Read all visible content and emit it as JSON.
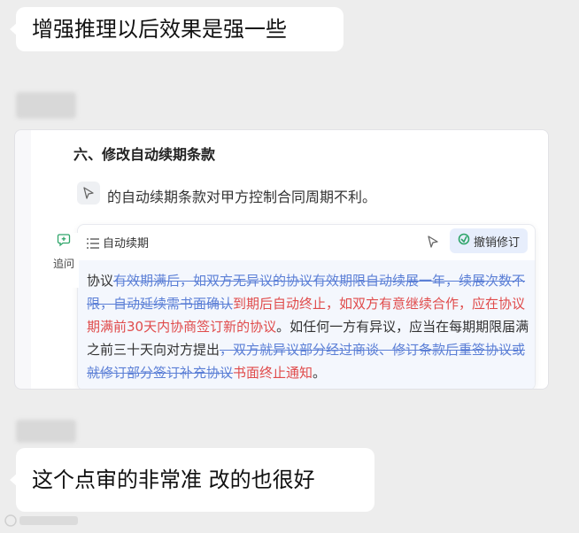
{
  "messages": {
    "top": "增强推理以后效果是强一些",
    "bottom": "这个点审的非常准 改的也很好"
  },
  "card": {
    "section_title": "六、修改自动续期条款",
    "comment": "的自动续期条款对甲方控制合同周期不利。",
    "followup_label": "追问",
    "panel_title": "自动续期",
    "revert_label": "撤销修订",
    "segments": [
      {
        "type": "normal",
        "text": "协议"
      },
      {
        "type": "deleted",
        "text": "有效期满后，如双方无异议的协议有效期限自动续展一年，续展次数不限，自动延续需书面确认"
      },
      {
        "type": "inserted",
        "text": "到期后自动终止，如双方有意继续合作，应在协议期满前30天内协商签订新的协议"
      },
      {
        "type": "normal",
        "text": "。如任何一方有异议，应当在每期期限届满之前三十天向对方提出"
      },
      {
        "type": "deleted",
        "text": "，双方就异议部分经过商谈、修订条款后重签协议或就修订部分签订补充协议"
      },
      {
        "type": "inserted",
        "text": "书面终止通知"
      },
      {
        "type": "normal",
        "text": "。"
      }
    ]
  },
  "colors": {
    "background": "#ededed",
    "bubble": "#ffffff",
    "deleted": "#5b7fd6",
    "inserted": "#e04b4b",
    "revert_bg": "#e7eefc",
    "panel_body": "#f4f7fd"
  },
  "icons": {
    "cursor": "cursor-arrow-icon",
    "list": "list-icon",
    "followup": "chat-plus-icon",
    "revert": "revert-icon"
  }
}
